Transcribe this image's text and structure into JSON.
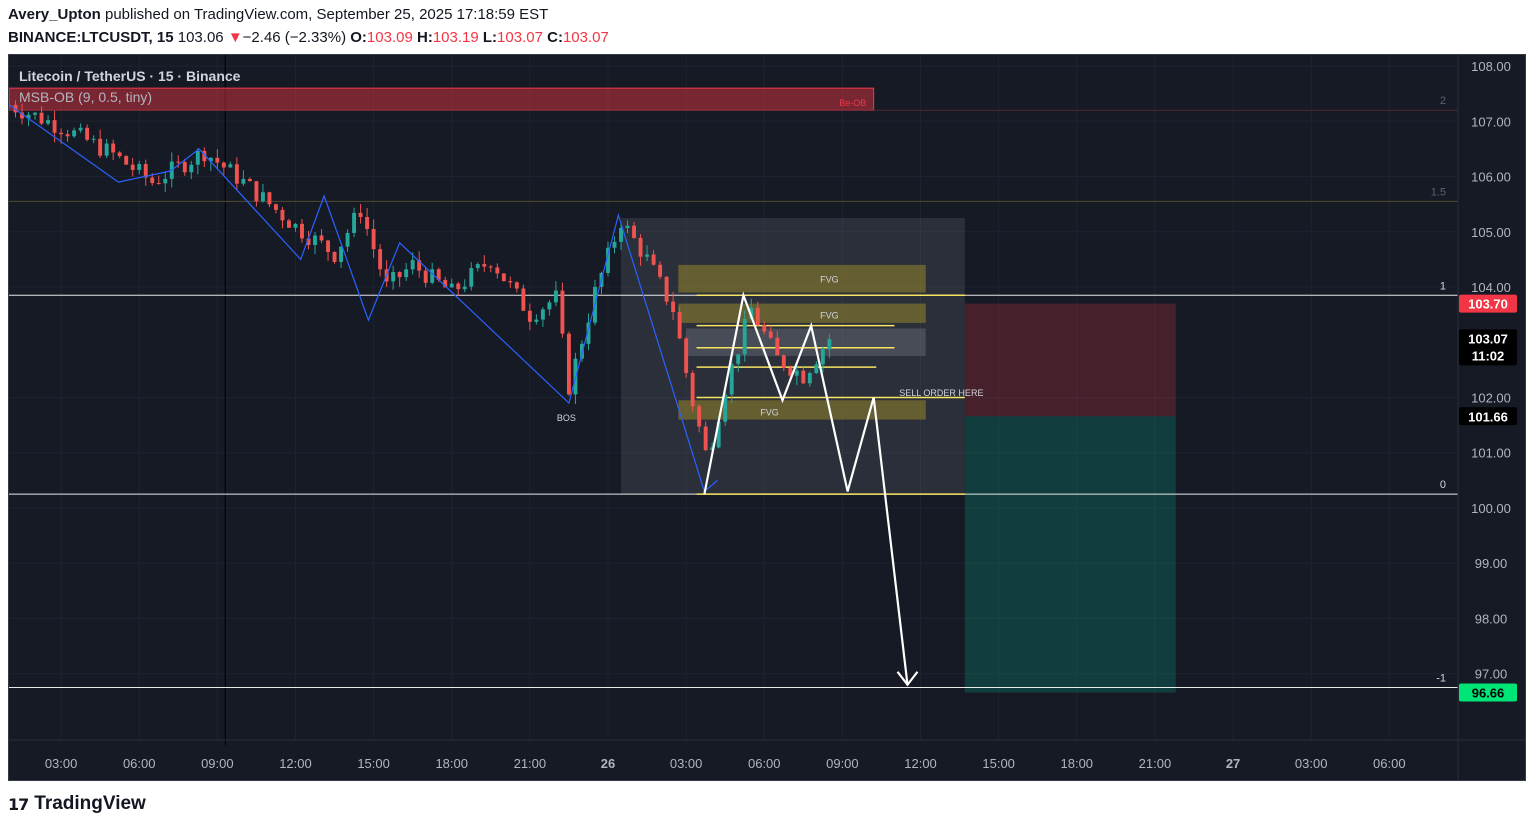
{
  "header": {
    "author": "Avery_Upton",
    "published": "published on TradingView.com, September 25, 2025 17:18:59 EST",
    "symbol": "BINANCE:LTCUSDT, 15",
    "last": "103.06",
    "arrow": "▼",
    "change": "−2.46 (−2.33%)",
    "o_label": "O:",
    "o": "103.09",
    "h_label": "H:",
    "h": "103.19",
    "l_label": "L:",
    "l": "103.07",
    "c_label": "C:",
    "c": "103.07"
  },
  "legend": {
    "title": "Litecoin / TetherUS · 15 · Binance",
    "indicator": "MSB-OB (9, 0.5, tiny)"
  },
  "footer": {
    "brand": "TradingView",
    "logo": "17"
  },
  "colors": {
    "background": "#161a25",
    "up": "#26a69a",
    "down": "#ef5350",
    "zigzag": "#2962ff",
    "fvg": "#8c7f2d",
    "fib_line": "#f7e463",
    "target_label": "#2dff9a",
    "stop_label": "#f23645"
  },
  "chart_data": {
    "type": "candlestick",
    "ylim": [
      95.8,
      108.2
    ],
    "y_ticks": [
      "108.00",
      "107.00",
      "106.00",
      "105.00",
      "104.00",
      "102.00",
      "101.00",
      "100.00",
      "99.00",
      "98.00",
      "97.00"
    ],
    "y_tick_values": [
      108,
      107,
      106,
      105,
      104,
      102,
      101,
      100,
      99,
      98,
      97
    ],
    "x_ticks": [
      {
        "label": "03:00",
        "t": 3
      },
      {
        "label": "06:00",
        "t": 6
      },
      {
        "label": "09:00",
        "t": 9
      },
      {
        "label": "12:00",
        "t": 12
      },
      {
        "label": "15:00",
        "t": 15
      },
      {
        "label": "18:00",
        "t": 18
      },
      {
        "label": "21:00",
        "t": 21
      },
      {
        "label": "26",
        "t": 24,
        "bold": true
      },
      {
        "label": "03:00",
        "t": 27
      },
      {
        "label": "06:00",
        "t": 30
      },
      {
        "label": "09:00",
        "t": 33
      },
      {
        "label": "12:00",
        "t": 36
      },
      {
        "label": "15:00",
        "t": 39
      },
      {
        "label": "18:00",
        "t": 42
      },
      {
        "label": "21:00",
        "t": 45
      },
      {
        "label": "27",
        "t": 48,
        "bold": true
      },
      {
        "label": "03:00",
        "t": 51
      },
      {
        "label": "06:00",
        "t": 54
      }
    ],
    "x_range": [
      1.0,
      56.1
    ],
    "price_labels": [
      {
        "text": "103.70",
        "value": 103.7,
        "bg": "#f23645",
        "fg": "#ffffff"
      },
      {
        "text": "103.07",
        "sub": "11:02",
        "value": 103.07,
        "bg": "#000000",
        "fg": "#ffffff"
      },
      {
        "text": "101.66",
        "value": 101.66,
        "bg": "#000000",
        "fg": "#ffffff"
      },
      {
        "text": "96.66",
        "value": 96.66,
        "bg": "#00e676",
        "fg": "#000000"
      }
    ],
    "fib_levels": [
      {
        "label": "2",
        "value": 107.2
      },
      {
        "label": "1.5",
        "value": 105.55
      },
      {
        "label": "1",
        "value": 103.85
      },
      {
        "label": "0",
        "value": 100.25
      },
      {
        "label": "-1",
        "value": 96.75
      }
    ],
    "anchors": [
      {
        "t": 1.0,
        "p": 107.3
      },
      {
        "t": 3.0,
        "p": 106.9
      },
      {
        "t": 5.0,
        "p": 106.4
      },
      {
        "t": 6.5,
        "p": 105.9
      },
      {
        "t": 8.5,
        "p": 106.45
      },
      {
        "t": 10.0,
        "p": 105.9
      },
      {
        "t": 12.0,
        "p": 105.1
      },
      {
        "t": 13.5,
        "p": 104.6
      },
      {
        "t": 14.5,
        "p": 105.4
      },
      {
        "t": 15.5,
        "p": 104.0
      },
      {
        "t": 16.5,
        "p": 104.4
      },
      {
        "t": 18.0,
        "p": 103.9
      },
      {
        "t": 19.5,
        "p": 104.5
      },
      {
        "t": 21.0,
        "p": 103.5
      },
      {
        "t": 22.0,
        "p": 103.8
      },
      {
        "t": 22.5,
        "p": 102.2
      },
      {
        "t": 23.5,
        "p": 103.9
      },
      {
        "t": 24.5,
        "p": 105.2
      },
      {
        "t": 25.5,
        "p": 104.5
      },
      {
        "t": 26.5,
        "p": 103.6
      },
      {
        "t": 27.2,
        "p": 102.0
      },
      {
        "t": 27.8,
        "p": 100.9
      },
      {
        "t": 28.5,
        "p": 102.2
      },
      {
        "t": 29.5,
        "p": 103.6
      },
      {
        "t": 30.5,
        "p": 102.7
      },
      {
        "t": 31.5,
        "p": 102.4
      },
      {
        "t": 32.5,
        "p": 103.07
      }
    ],
    "annotations": [
      {
        "text": "BOS",
        "t": 22.4,
        "p": 101.65
      },
      {
        "text": "FVG",
        "t": 32.5,
        "p": 104.15
      },
      {
        "text": "FVG",
        "t": 32.5,
        "p": 103.5
      },
      {
        "text": "FVG",
        "t": 30.2,
        "p": 101.75
      },
      {
        "text": "SELL ORDER HERE",
        "t": 36.8,
        "p": 102.1
      },
      {
        "text": "Be-OB",
        "t": 33.4,
        "p": 107.35
      }
    ],
    "zigzag": [
      {
        "t": 1.0,
        "p": 107.3
      },
      {
        "t": 5.2,
        "p": 105.9
      },
      {
        "t": 7.2,
        "p": 106.1
      },
      {
        "t": 8.3,
        "p": 106.5
      },
      {
        "t": 12.2,
        "p": 104.5
      },
      {
        "t": 13.1,
        "p": 105.65
      },
      {
        "t": 14.8,
        "p": 103.4
      },
      {
        "t": 16.0,
        "p": 104.8
      },
      {
        "t": 22.5,
        "p": 101.9
      },
      {
        "t": 24.4,
        "p": 105.3
      },
      {
        "t": 27.7,
        "p": 100.3
      },
      {
        "t": 28.2,
        "p": 100.5
      }
    ],
    "projection": [
      {
        "t": 27.7,
        "p": 100.25
      },
      {
        "t": 29.2,
        "p": 103.85
      },
      {
        "t": 30.7,
        "p": 101.95
      },
      {
        "t": 31.8,
        "p": 103.3
      },
      {
        "t": 33.2,
        "p": 100.3
      },
      {
        "t": 34.2,
        "p": 102.0
      },
      {
        "t": 35.5,
        "p": 96.8
      }
    ],
    "fvg_zones": [
      {
        "t0": 26.7,
        "t1": 36.2,
        "top": 104.4,
        "bottom": 103.9
      },
      {
        "t0": 26.7,
        "t1": 36.2,
        "top": 103.7,
        "bottom": 103.35
      },
      {
        "t0": 26.7,
        "t1": 36.2,
        "top": 101.95,
        "bottom": 101.6
      }
    ],
    "gray_zone": {
      "t0": 24.5,
      "t1": 37.7,
      "top": 105.25,
      "bottom": 100.25
    },
    "gray_inner": {
      "t0": 27.0,
      "t1": 36.2,
      "top": 103.25,
      "bottom": 102.75
    },
    "yellow_lines": [
      {
        "t0": 27.4,
        "t1": 35.0,
        "p": 103.3
      },
      {
        "t0": 27.4,
        "t1": 35.0,
        "p": 102.9
      },
      {
        "t0": 27.4,
        "t1": 34.3,
        "p": 102.55
      },
      {
        "t0": 27.4,
        "t1": 37.7,
        "p": 102.0
      }
    ],
    "position": {
      "t0": 37.7,
      "t1": 45.8,
      "stop": 103.7,
      "entry": 101.66,
      "target": 96.66
    },
    "ob_box": {
      "t0": 1.0,
      "t1": 34.2,
      "top": 107.6,
      "bottom": 107.2
    }
  }
}
